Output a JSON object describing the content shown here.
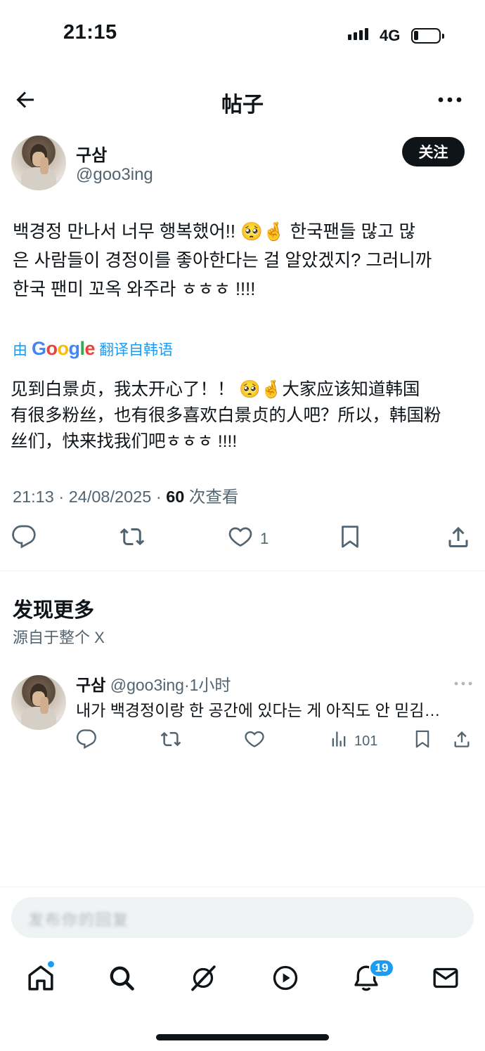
{
  "status_bar": {
    "time": "21:15",
    "network": "4G"
  },
  "nav": {
    "title": "帖子"
  },
  "post": {
    "author_name": "구삼",
    "author_handle": "@goo3ing",
    "follow_label": "关注",
    "text_line1": "백경정 만나서 너무 행복했어!! 🥺🤞 한국팬들 많고 많",
    "text_line2": "은 사람들이 경정이를 좋아한다는 걸 알았겠지? 그러니까",
    "text_line3": "한국 팬미 꼬옥 와주라 ㅎㅎㅎ !!!!",
    "translate_prefix": "由",
    "translate_suffix": "翻译自韩语",
    "translated_line1": "见到白景贞，我太开心了！！ 🥺🤞大家应该知道韩国",
    "translated_line2": "有很多粉丝，也有很多喜欢白景贞的人吧？所以，韩国粉",
    "translated_line3": "丝们，快来找我们吧ㅎㅎㅎ !!!!",
    "meta_time": "21:13 · 24/08/2025 · ",
    "meta_views": "60",
    "meta_views_label": " 次查看",
    "likes": "1"
  },
  "discover": {
    "title": "发现更多",
    "subtitle": "源自于整个 X"
  },
  "related": {
    "author_name": "구삼",
    "author_handle": "@goo3ing",
    "age": "·1小时",
    "text": "내가 백경정이랑 한 공간에 있다는 게 아직도 안 믿김…",
    "views": "101"
  },
  "compose": {
    "placeholder": "发布你的回复"
  },
  "tabbar": {
    "notifications_badge": "19"
  },
  "icons": [
    "arrow-left-icon",
    "more-icon",
    "reply-icon",
    "retweet-icon",
    "heart-icon",
    "bookmark-icon",
    "share-icon",
    "views-icon",
    "home-icon",
    "search-icon",
    "grok-icon",
    "video-icon",
    "bell-icon",
    "mail-icon"
  ]
}
